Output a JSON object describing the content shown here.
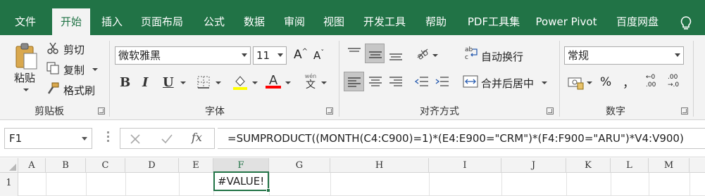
{
  "tabs": [
    {
      "label": "文件",
      "active": false
    },
    {
      "label": "开始",
      "active": true
    },
    {
      "label": "插入",
      "active": false
    },
    {
      "label": "页面布局",
      "active": false
    },
    {
      "label": "公式",
      "active": false
    },
    {
      "label": "数据",
      "active": false
    },
    {
      "label": "审阅",
      "active": false
    },
    {
      "label": "视图",
      "active": false
    },
    {
      "label": "开发工具",
      "active": false
    },
    {
      "label": "帮助",
      "active": false
    },
    {
      "label": "PDF工具集",
      "active": false
    },
    {
      "label": "Power Pivot",
      "active": false
    },
    {
      "label": "百度网盘",
      "active": false
    }
  ],
  "clipboard": {
    "paste": "粘贴",
    "cut": "剪切",
    "copy": "复制",
    "format_painter": "格式刷",
    "group": "剪贴板"
  },
  "font": {
    "name": "微软雅黑",
    "size": "11",
    "grow": "A",
    "shrink": "A",
    "bold": "B",
    "italic": "I",
    "underline": "U",
    "font_color_glyph": "A",
    "phonetic": "文",
    "phonetic_top": "wén",
    "group": "字体"
  },
  "alignment": {
    "wrap": "自动换行",
    "merge": "合并后居中",
    "group": "对齐方式"
  },
  "number": {
    "format": "常规",
    "percent": "%",
    "comma": "，",
    "inc_top": "←0",
    "inc_bottom": ".00",
    "dec_top": ".00",
    "dec_bottom": "→.0",
    "group": "数字"
  },
  "formula_bar": {
    "name_box": "F1",
    "fx": "fx",
    "formula": "=SUMPRODUCT((MONTH(C4:C900)=1)*(E4:E900=\"CRM\")*(F4:F900=\"ARU\")*V4:V900)"
  },
  "grid": {
    "columns": [
      "A",
      "B",
      "C",
      "D",
      "E",
      "F",
      "G",
      "H",
      "I",
      "J",
      "K",
      "L",
      "M"
    ],
    "selected_column": "F",
    "rows": [
      "1"
    ],
    "active_cell_value": "#VALUE!"
  },
  "colors": {
    "brand": "#217346",
    "font_color_bar": "#ff0000",
    "highlight_bar": "#ffff00"
  }
}
